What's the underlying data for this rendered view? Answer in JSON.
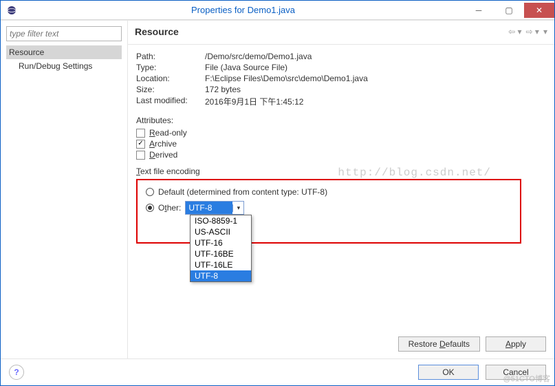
{
  "window": {
    "title": "Properties for Demo1.java"
  },
  "sidebar": {
    "filter_placeholder": "type filter text",
    "items": [
      "Resource",
      "Run/Debug Settings"
    ]
  },
  "section": {
    "title": "Resource"
  },
  "info": {
    "path_label": "Path:",
    "path_value": "/Demo/src/demo/Demo1.java",
    "type_label": "Type:",
    "type_value": "File  (Java Source File)",
    "location_label": "Location:",
    "location_value": "F:\\Eclipse Files\\Demo\\src\\demo\\Demo1.java",
    "size_label": "Size:",
    "size_value": "172  bytes",
    "modified_label": "Last modified:",
    "modified_value": "2016年9月1日 下午1:45:12"
  },
  "attributes": {
    "title": "Attributes:",
    "readonly_label": "Read-only",
    "archive_label": "Archive",
    "derived_label": "Derived",
    "readonly_checked": false,
    "archive_checked": true,
    "derived_checked": false
  },
  "encoding": {
    "group_label": "Text file encoding",
    "default_label": "Default (determined from content type: UTF-8)",
    "other_label": "Other:",
    "selected_value": "UTF-8",
    "options": [
      "ISO-8859-1",
      "US-ASCII",
      "UTF-16",
      "UTF-16BE",
      "UTF-16LE",
      "UTF-8"
    ],
    "highlighted_option_index": 5
  },
  "buttons": {
    "restore": "Restore Defaults",
    "apply": "Apply",
    "ok": "OK",
    "cancel": "Cancel"
  },
  "watermark": {
    "url": "http://blog.csdn.net/",
    "corner": "@51CTO博客"
  }
}
